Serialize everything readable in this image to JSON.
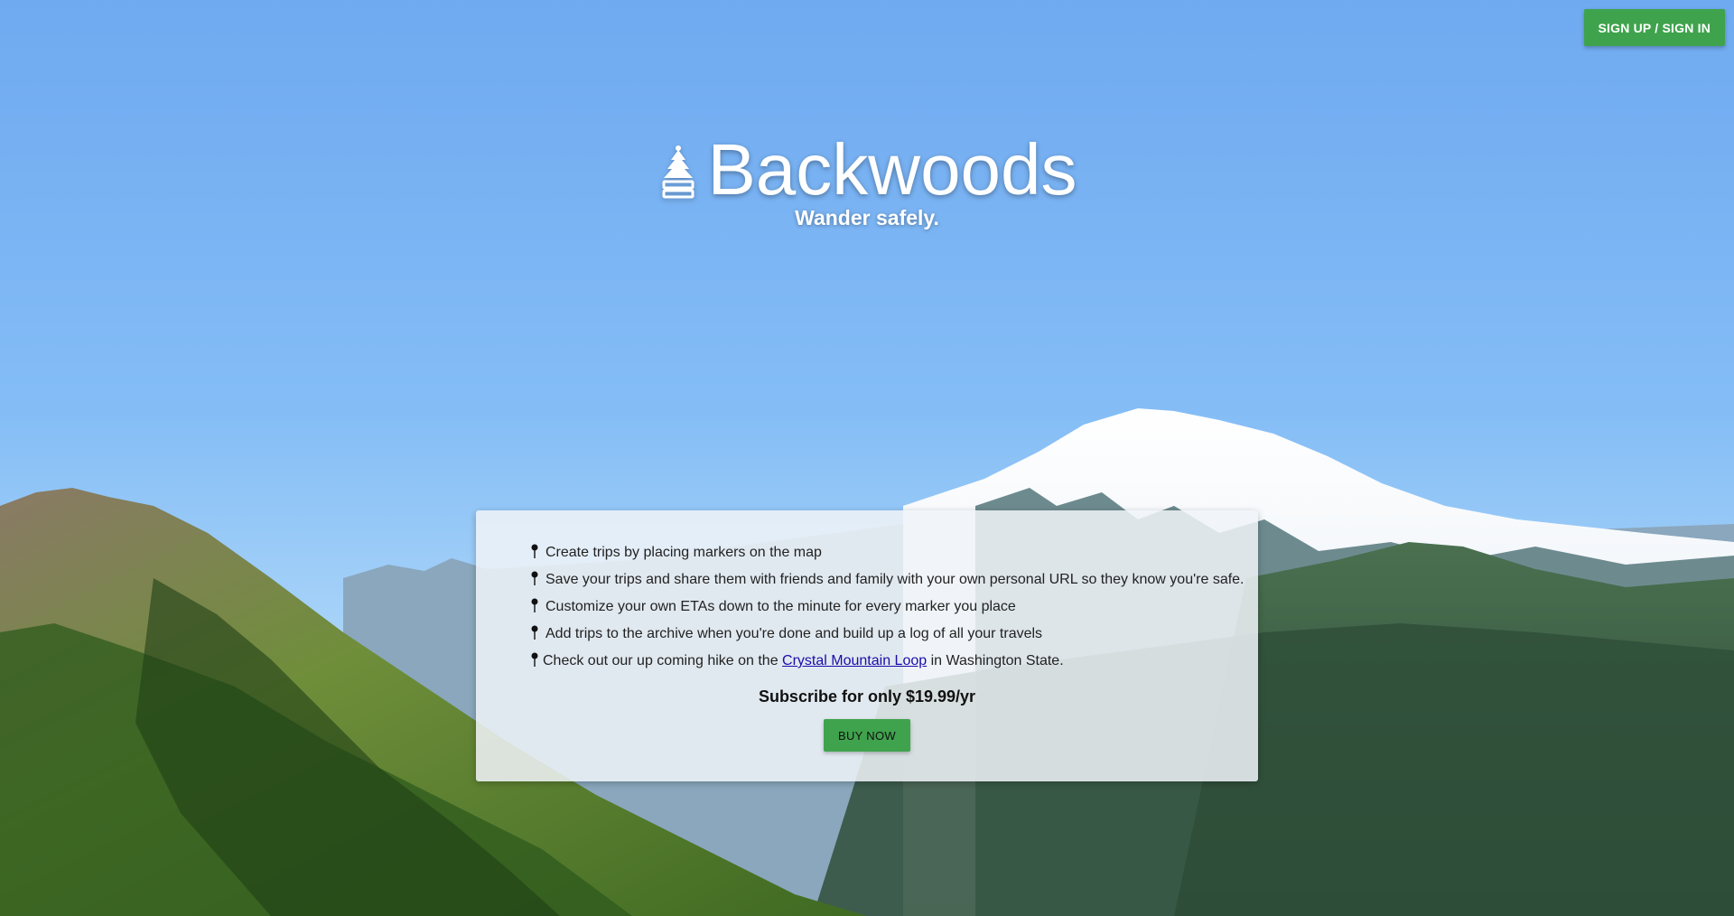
{
  "header": {
    "auth_label": "SIGN UP / SIGN IN"
  },
  "brand": {
    "logo_icon": "pine-tree-icon",
    "title": "Backwoods",
    "tagline": "Wander safely."
  },
  "features": {
    "marker_icon": "map-pin-icon",
    "items": [
      {
        "text": "Create trips by placing markers on the map"
      },
      {
        "text": "Save your trips and share them with friends and family with your own personal URL so they know you're safe."
      },
      {
        "text": "Customize your own ETAs down to the minute for every marker you place"
      },
      {
        "text": "Add trips to the archive when you're done and build up a log of all your travels"
      }
    ],
    "hike": {
      "prefix": "Check out our up coming hike on the ",
      "link_text": "Crystal Mountain Loop",
      "suffix": " in Washington State."
    }
  },
  "subscribe": {
    "text": "Subscribe for only $19.99/yr",
    "buy_label": "BUY NOW"
  },
  "colors": {
    "accent_green": "#3fa34d",
    "sky": "#7db4f0",
    "link": "#1a0dab"
  }
}
